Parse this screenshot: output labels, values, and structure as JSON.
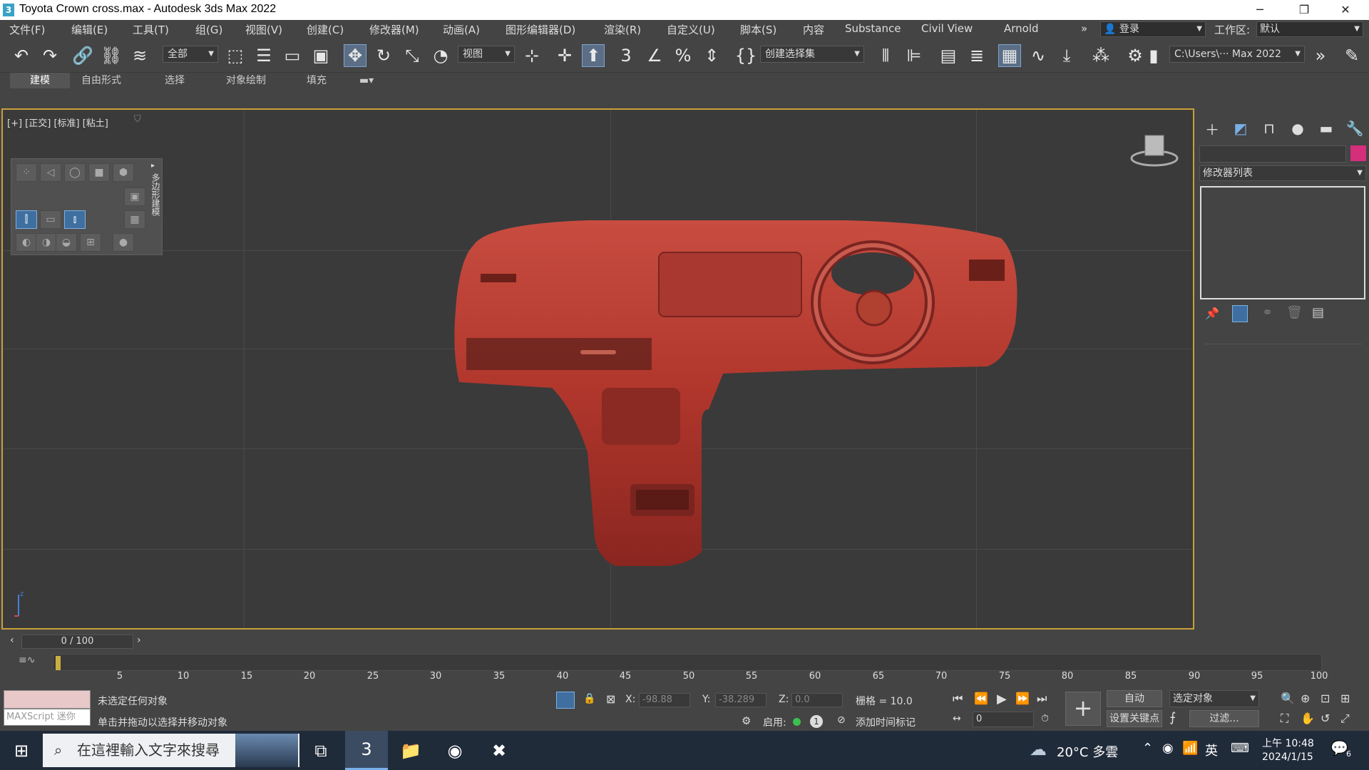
{
  "window": {
    "title": "Toyota Crown cross.max - Autodesk 3ds Max 2022",
    "app_icon": "3",
    "controls": [
      "─",
      "❐",
      "✕"
    ]
  },
  "menu": {
    "items": [
      "文件(F)",
      "编辑(E)",
      "工具(T)",
      "组(G)",
      "视图(V)",
      "创建(C)",
      "修改器(M)",
      "动画(A)",
      "图形编辑器(D)",
      "渲染(R)",
      "自定义(U)",
      "脚本(S)",
      "内容",
      "Substance",
      "Civil View",
      "Arnold"
    ],
    "overflow": "»",
    "login": "登录",
    "workspace_label": "工作区:",
    "workspace_value": "默认"
  },
  "toolbar": {
    "selection_filter": "全部",
    "ref_coord": "视图",
    "named_selection": "创建选择集",
    "project_path": "C:\\Users\\··· Max 2022"
  },
  "ribbon": {
    "tabs": [
      "建模",
      "自由形式",
      "选择",
      "对象绘制",
      "填充"
    ]
  },
  "viewport": {
    "label": "[+] [正交] [标准] [粘土]",
    "mini_panel_title": "多边形建模"
  },
  "command_panel": {
    "modifier_list": "修改器列表",
    "object_color": "#d42f7a"
  },
  "timeline": {
    "frame_display": "0 / 100",
    "ticks": [
      "5",
      "10",
      "15",
      "20",
      "25",
      "30",
      "35",
      "40",
      "45",
      "50",
      "55",
      "60",
      "65",
      "70",
      "75",
      "80",
      "85",
      "90",
      "95",
      "100"
    ]
  },
  "status": {
    "maxscript_label": "MAXScript 迷你",
    "line1": "未选定任何对象",
    "line2": "单击并拖动以选择并移动对象",
    "x_label": "X:",
    "x_value": "-98.88",
    "y_label": "Y:",
    "y_value": "-38.289",
    "z_label": "Z:",
    "z_value": "0.0",
    "grid": "栅格 = 10.0",
    "enable_label": "启用:",
    "add_time_tag": "添加时间标记",
    "auto_key": "自动",
    "set_key": "设置关键点",
    "selected_object": "选定对象",
    "filters": "过滤...",
    "frame_field": "0"
  },
  "taskbar": {
    "search_placeholder": "在這裡輸入文字來搜尋",
    "weather": "20°C 多雲",
    "ime": "英",
    "time": "上午 10:48",
    "date": "2024/1/15",
    "notification_count": "6"
  }
}
